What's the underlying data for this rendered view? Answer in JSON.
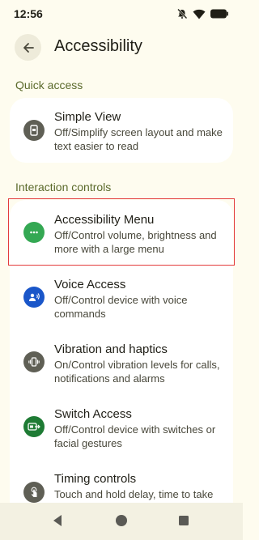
{
  "status_bar": {
    "time": "12:56"
  },
  "header": {
    "title": "Accessibility"
  },
  "sections": {
    "quick_access": "Quick access",
    "interaction_controls": "Interaction controls"
  },
  "items": {
    "simple_view": {
      "title": "Simple View",
      "subtitle": "Off/Simplify screen layout and make text easier to read",
      "icon_color": "#5F5F55"
    },
    "accessibility_menu": {
      "title": "Accessibility Menu",
      "subtitle": "Off/Control volume, brightness and more with a large menu",
      "icon_color": "#34A853"
    },
    "voice_access": {
      "title": "Voice Access",
      "subtitle": "Off/Control device with voice commands",
      "icon_color": "#1A56C9"
    },
    "vibration": {
      "title": "Vibration and haptics",
      "subtitle": "On/Control vibration levels for calls, notifications and alarms",
      "icon_color": "#5F5F55"
    },
    "switch_access": {
      "title": "Switch Access",
      "subtitle": "Off/Control device with switches or facial gestures",
      "icon_color": "#1E7B34"
    },
    "timing_controls": {
      "title": "Timing controls",
      "subtitle": "Touch and hold delay, time to take action",
      "icon_color": "#5F5F55"
    }
  }
}
